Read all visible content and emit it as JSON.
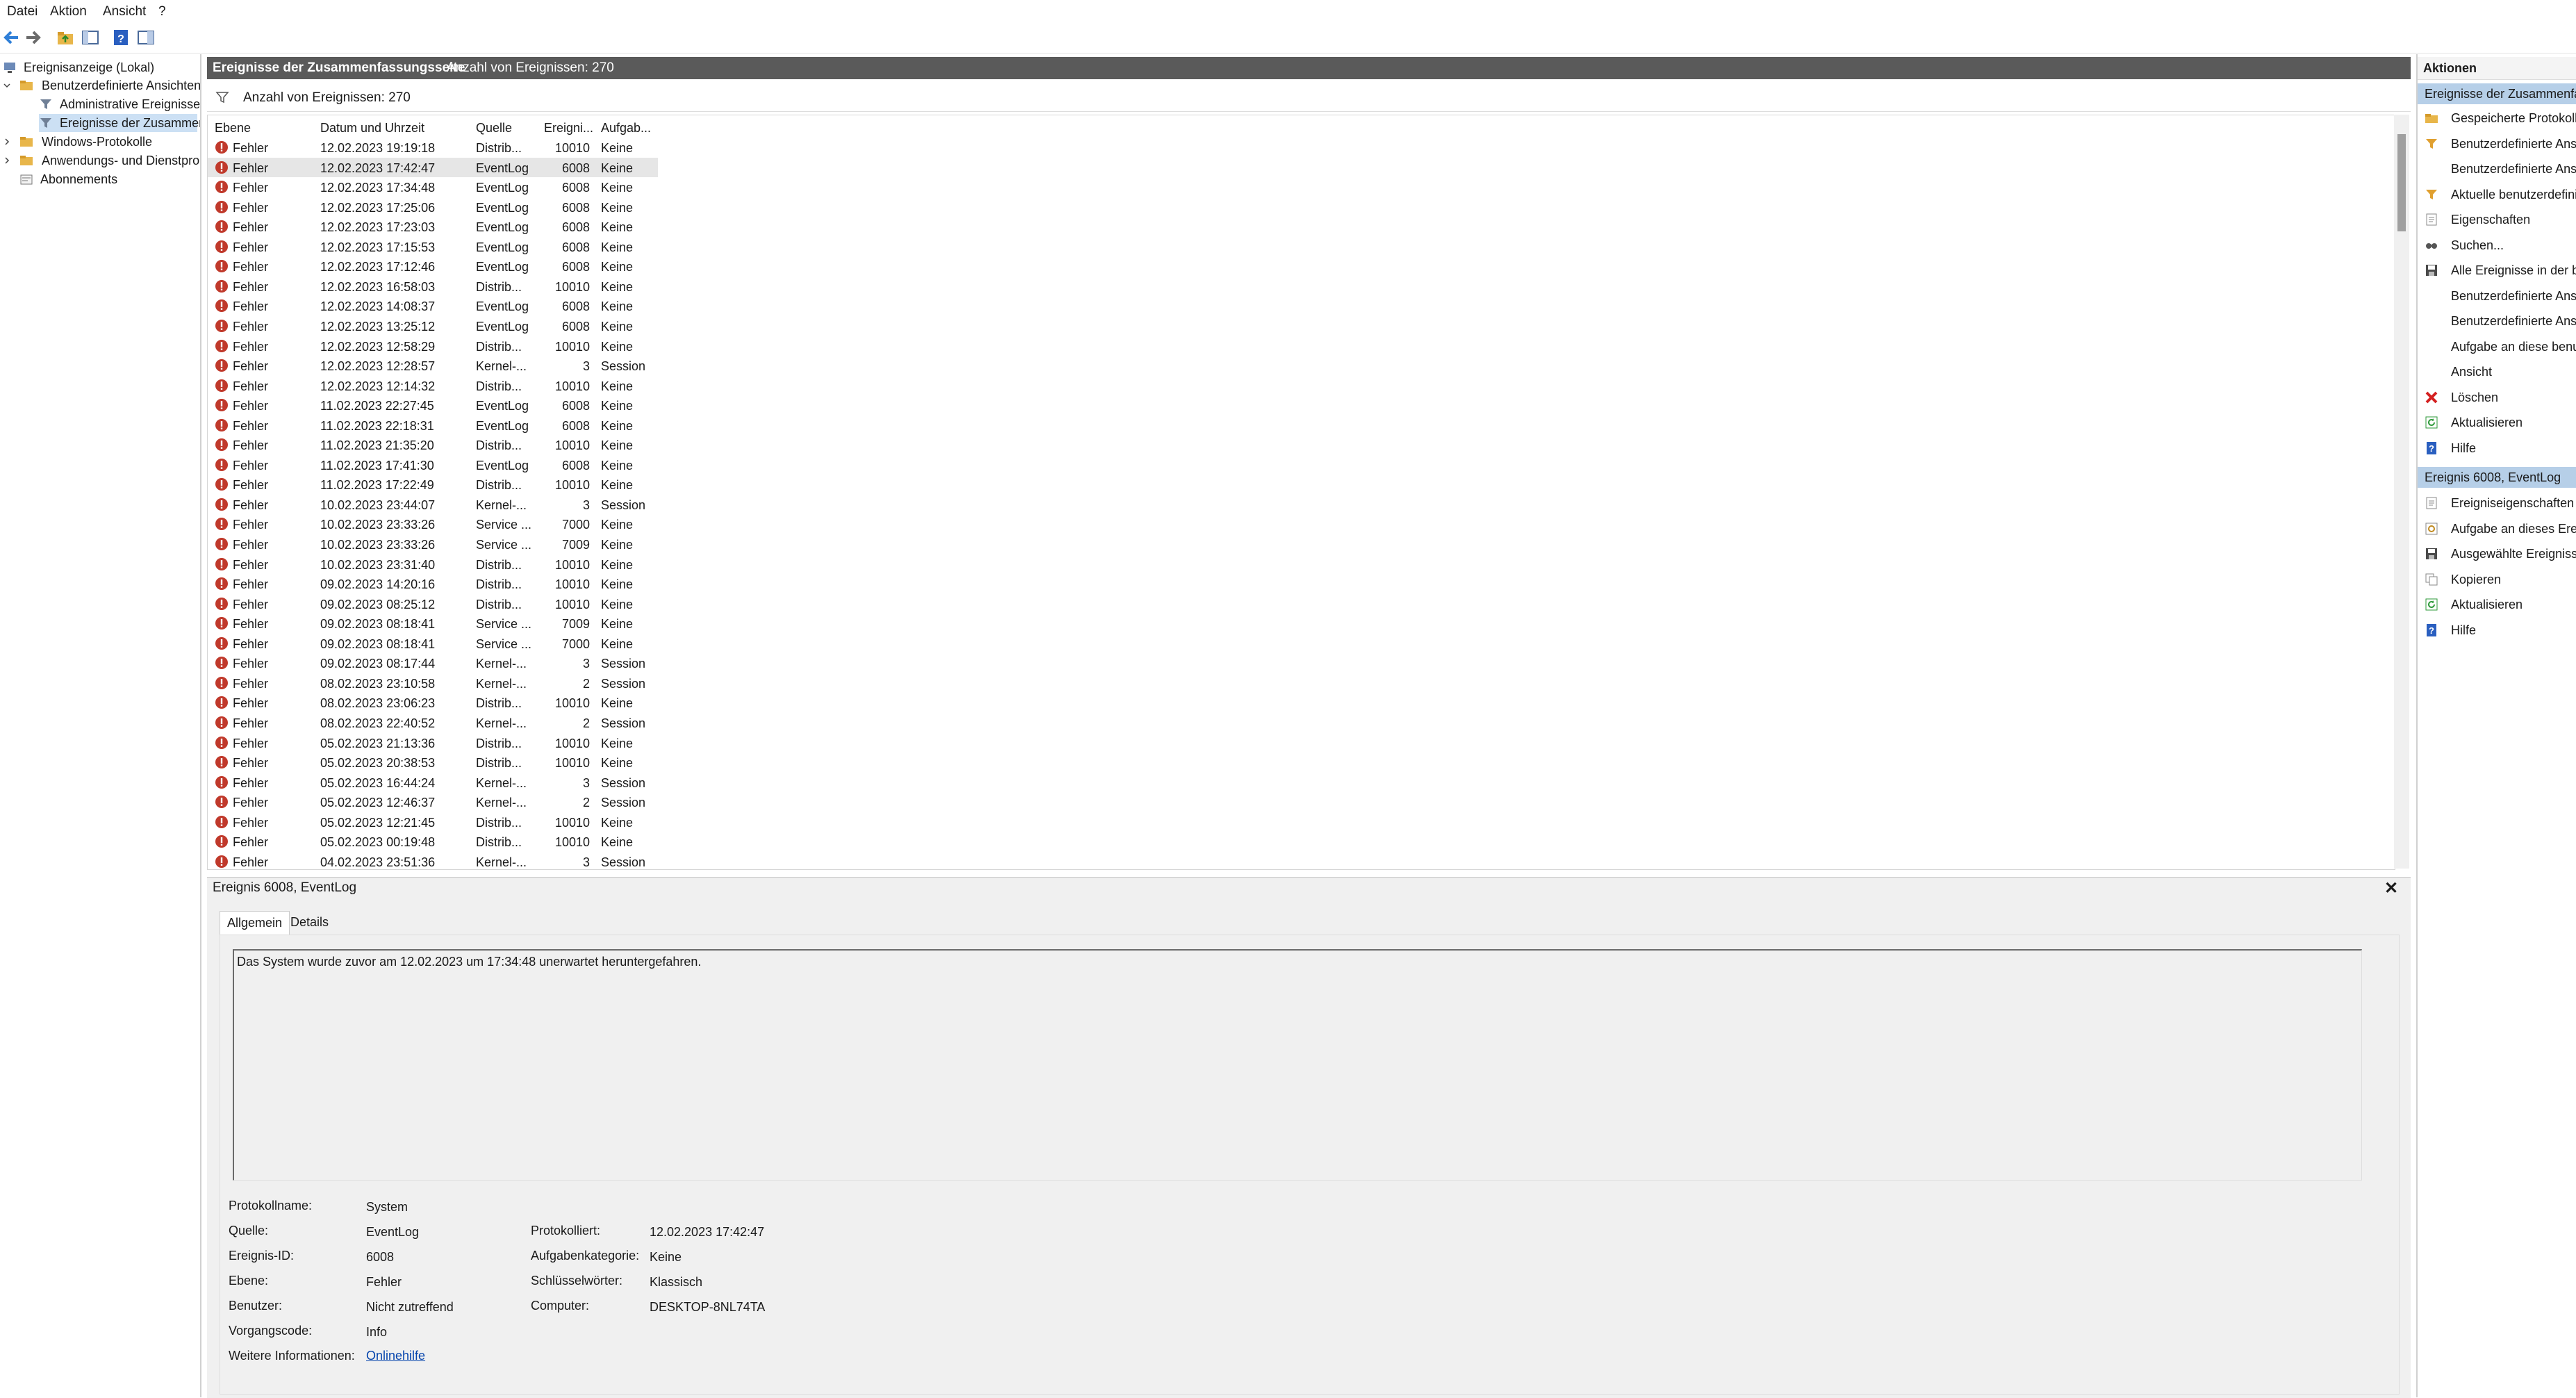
{
  "menu": [
    "Datei",
    "Aktion",
    "Ansicht",
    "?"
  ],
  "tree": [
    {
      "label": "Ereignisanzeige (Lokal)",
      "icon": "computer-icon"
    },
    {
      "label": "Benutzerdefinierte Ansichten",
      "icon": "folder-icon"
    },
    {
      "label": "Administrative Ereignisse",
      "icon": "filter-icon"
    },
    {
      "label": "Ereignisse der Zusammen",
      "icon": "filter-icon"
    },
    {
      "label": "Windows-Protokolle",
      "icon": "folder-icon"
    },
    {
      "label": "Anwendungs- und Dienstpro",
      "icon": "folder-icon"
    },
    {
      "label": "Abonnements",
      "icon": "subscription-icon"
    }
  ],
  "middle": {
    "title": "Ereignisse der Zusammenfassungsseite",
    "count": "Anzahl von Ereignissen: 270",
    "filter_count": "Anzahl von Ereignissen: 270"
  },
  "columns": [
    "Ebene",
    "Datum und Uhrzeit",
    "Quelle",
    "Ereigni...",
    "Aufgab..."
  ],
  "rows": [
    {
      "level": "Fehler",
      "date": "12.02.2023 19:19:18",
      "source": "Distrib...",
      "id": "10010",
      "task": "Keine"
    },
    {
      "level": "Fehler",
      "date": "12.02.2023 17:42:47",
      "source": "EventLog",
      "id": "6008",
      "task": "Keine"
    },
    {
      "level": "Fehler",
      "date": "12.02.2023 17:34:48",
      "source": "EventLog",
      "id": "6008",
      "task": "Keine"
    },
    {
      "level": "Fehler",
      "date": "12.02.2023 17:25:06",
      "source": "EventLog",
      "id": "6008",
      "task": "Keine"
    },
    {
      "level": "Fehler",
      "date": "12.02.2023 17:23:03",
      "source": "EventLog",
      "id": "6008",
      "task": "Keine"
    },
    {
      "level": "Fehler",
      "date": "12.02.2023 17:15:53",
      "source": "EventLog",
      "id": "6008",
      "task": "Keine"
    },
    {
      "level": "Fehler",
      "date": "12.02.2023 17:12:46",
      "source": "EventLog",
      "id": "6008",
      "task": "Keine"
    },
    {
      "level": "Fehler",
      "date": "12.02.2023 16:58:03",
      "source": "Distrib...",
      "id": "10010",
      "task": "Keine"
    },
    {
      "level": "Fehler",
      "date": "12.02.2023 14:08:37",
      "source": "EventLog",
      "id": "6008",
      "task": "Keine"
    },
    {
      "level": "Fehler",
      "date": "12.02.2023 13:25:12",
      "source": "EventLog",
      "id": "6008",
      "task": "Keine"
    },
    {
      "level": "Fehler",
      "date": "12.02.2023 12:58:29",
      "source": "Distrib...",
      "id": "10010",
      "task": "Keine"
    },
    {
      "level": "Fehler",
      "date": "12.02.2023 12:28:57",
      "source": "Kernel-...",
      "id": "3",
      "task": "Session"
    },
    {
      "level": "Fehler",
      "date": "12.02.2023 12:14:32",
      "source": "Distrib...",
      "id": "10010",
      "task": "Keine"
    },
    {
      "level": "Fehler",
      "date": "11.02.2023 22:27:45",
      "source": "EventLog",
      "id": "6008",
      "task": "Keine"
    },
    {
      "level": "Fehler",
      "date": "11.02.2023 22:18:31",
      "source": "EventLog",
      "id": "6008",
      "task": "Keine"
    },
    {
      "level": "Fehler",
      "date": "11.02.2023 21:35:20",
      "source": "Distrib...",
      "id": "10010",
      "task": "Keine"
    },
    {
      "level": "Fehler",
      "date": "11.02.2023 17:41:30",
      "source": "EventLog",
      "id": "6008",
      "task": "Keine"
    },
    {
      "level": "Fehler",
      "date": "11.02.2023 17:22:49",
      "source": "Distrib...",
      "id": "10010",
      "task": "Keine"
    },
    {
      "level": "Fehler",
      "date": "10.02.2023 23:44:07",
      "source": "Kernel-...",
      "id": "3",
      "task": "Session"
    },
    {
      "level": "Fehler",
      "date": "10.02.2023 23:33:26",
      "source": "Service ...",
      "id": "7000",
      "task": "Keine"
    },
    {
      "level": "Fehler",
      "date": "10.02.2023 23:33:26",
      "source": "Service ...",
      "id": "7009",
      "task": "Keine"
    },
    {
      "level": "Fehler",
      "date": "10.02.2023 23:31:40",
      "source": "Distrib...",
      "id": "10010",
      "task": "Keine"
    },
    {
      "level": "Fehler",
      "date": "09.02.2023 14:20:16",
      "source": "Distrib...",
      "id": "10010",
      "task": "Keine"
    },
    {
      "level": "Fehler",
      "date": "09.02.2023 08:25:12",
      "source": "Distrib...",
      "id": "10010",
      "task": "Keine"
    },
    {
      "level": "Fehler",
      "date": "09.02.2023 08:18:41",
      "source": "Service ...",
      "id": "7009",
      "task": "Keine"
    },
    {
      "level": "Fehler",
      "date": "09.02.2023 08:18:41",
      "source": "Service ...",
      "id": "7000",
      "task": "Keine"
    },
    {
      "level": "Fehler",
      "date": "09.02.2023 08:17:44",
      "source": "Kernel-...",
      "id": "3",
      "task": "Session"
    },
    {
      "level": "Fehler",
      "date": "08.02.2023 23:10:58",
      "source": "Kernel-...",
      "id": "2",
      "task": "Session"
    },
    {
      "level": "Fehler",
      "date": "08.02.2023 23:06:23",
      "source": "Distrib...",
      "id": "10010",
      "task": "Keine"
    },
    {
      "level": "Fehler",
      "date": "08.02.2023 22:40:52",
      "source": "Kernel-...",
      "id": "2",
      "task": "Session"
    },
    {
      "level": "Fehler",
      "date": "05.02.2023 21:13:36",
      "source": "Distrib...",
      "id": "10010",
      "task": "Keine"
    },
    {
      "level": "Fehler",
      "date": "05.02.2023 20:38:53",
      "source": "Distrib...",
      "id": "10010",
      "task": "Keine"
    },
    {
      "level": "Fehler",
      "date": "05.02.2023 16:44:24",
      "source": "Kernel-...",
      "id": "3",
      "task": "Session"
    },
    {
      "level": "Fehler",
      "date": "05.02.2023 12:46:37",
      "source": "Kernel-...",
      "id": "2",
      "task": "Session"
    },
    {
      "level": "Fehler",
      "date": "05.02.2023 12:21:45",
      "source": "Distrib...",
      "id": "10010",
      "task": "Keine"
    },
    {
      "level": "Fehler",
      "date": "05.02.2023 00:19:48",
      "source": "Distrib...",
      "id": "10010",
      "task": "Keine"
    },
    {
      "level": "Fehler",
      "date": "04.02.2023 23:51:36",
      "source": "Kernel-...",
      "id": "3",
      "task": "Session"
    }
  ],
  "detail": {
    "title": "Ereignis 6008, EventLog",
    "close": "✕",
    "tabs": [
      "Allgemein",
      "Details"
    ],
    "message": "Das System wurde zuvor am 12.02.2023 um 17:34:48 unerwartet heruntergefahren.",
    "labels": {
      "protokollname": "Protokollname:",
      "quelle": "Quelle:",
      "ereignis_id": "Ereignis-ID:",
      "ebene": "Ebene:",
      "benutzer": "Benutzer:",
      "vorgangscode": "Vorgangscode:",
      "weitere": "Weitere Informationen:",
      "protokolliert": "Protokolliert:",
      "aufgabenkategorie": "Aufgabenkategorie:",
      "schluesselwoerter": "Schlüsselwörter:",
      "computer": "Computer:"
    },
    "values": {
      "protokollname": "System",
      "quelle": "EventLog",
      "ereignis_id": "6008",
      "ebene": "Fehler",
      "benutzer": "Nicht zutreffend",
      "vorgangscode": "Info",
      "weitere": "Onlinehilfe",
      "protokolliert": "12.02.2023 17:42:47",
      "aufgabenkategorie": "Keine",
      "schluesselwoerter": "Klassisch",
      "computer": "DESKTOP-8NL74TA"
    }
  },
  "actions": {
    "header": "Aktionen",
    "section1": "Ereignisse der Zusammenfa",
    "items1": [
      {
        "label": "Gespeicherte Protokolld",
        "icon": "open-log-icon"
      },
      {
        "label": "Benutzerdefinierte Ansi",
        "icon": "filter-icon"
      },
      {
        "label": "Benutzerdefinierte Ansi",
        "icon": "none"
      },
      {
        "label": "Aktuelle benutzerdefini",
        "icon": "filter-icon"
      },
      {
        "label": "Eigenschaften",
        "icon": "properties-icon"
      },
      {
        "label": "Suchen...",
        "icon": "find-icon"
      },
      {
        "label": "Alle Ereignisse in der be",
        "icon": "save-icon"
      },
      {
        "label": "Benutzerdefinierte Ansi",
        "icon": "none"
      },
      {
        "label": "Benutzerdefinierte Ansi",
        "icon": "none"
      },
      {
        "label": "Aufgabe an diese benu",
        "icon": "none"
      },
      {
        "label": "Ansicht",
        "icon": "none"
      },
      {
        "label": "Löschen",
        "icon": "delete-icon"
      },
      {
        "label": "Aktualisieren",
        "icon": "refresh-icon"
      },
      {
        "label": "Hilfe",
        "icon": "help-icon"
      }
    ],
    "section2": "Ereignis 6008, EventLog",
    "items2": [
      {
        "label": "Ereigniseigenschaften",
        "icon": "properties-icon"
      },
      {
        "label": "Aufgabe an dieses Ereig",
        "icon": "task-icon"
      },
      {
        "label": "Ausgewählte Ereignisse",
        "icon": "save-icon"
      },
      {
        "label": "Kopieren",
        "icon": "copy-icon"
      },
      {
        "label": "Aktualisieren",
        "icon": "refresh-icon"
      },
      {
        "label": "Hilfe",
        "icon": "help-icon"
      }
    ]
  },
  "colors": {
    "error": "#c0392b",
    "header": "#5a5a5a",
    "selection": "#b6cfe8"
  }
}
